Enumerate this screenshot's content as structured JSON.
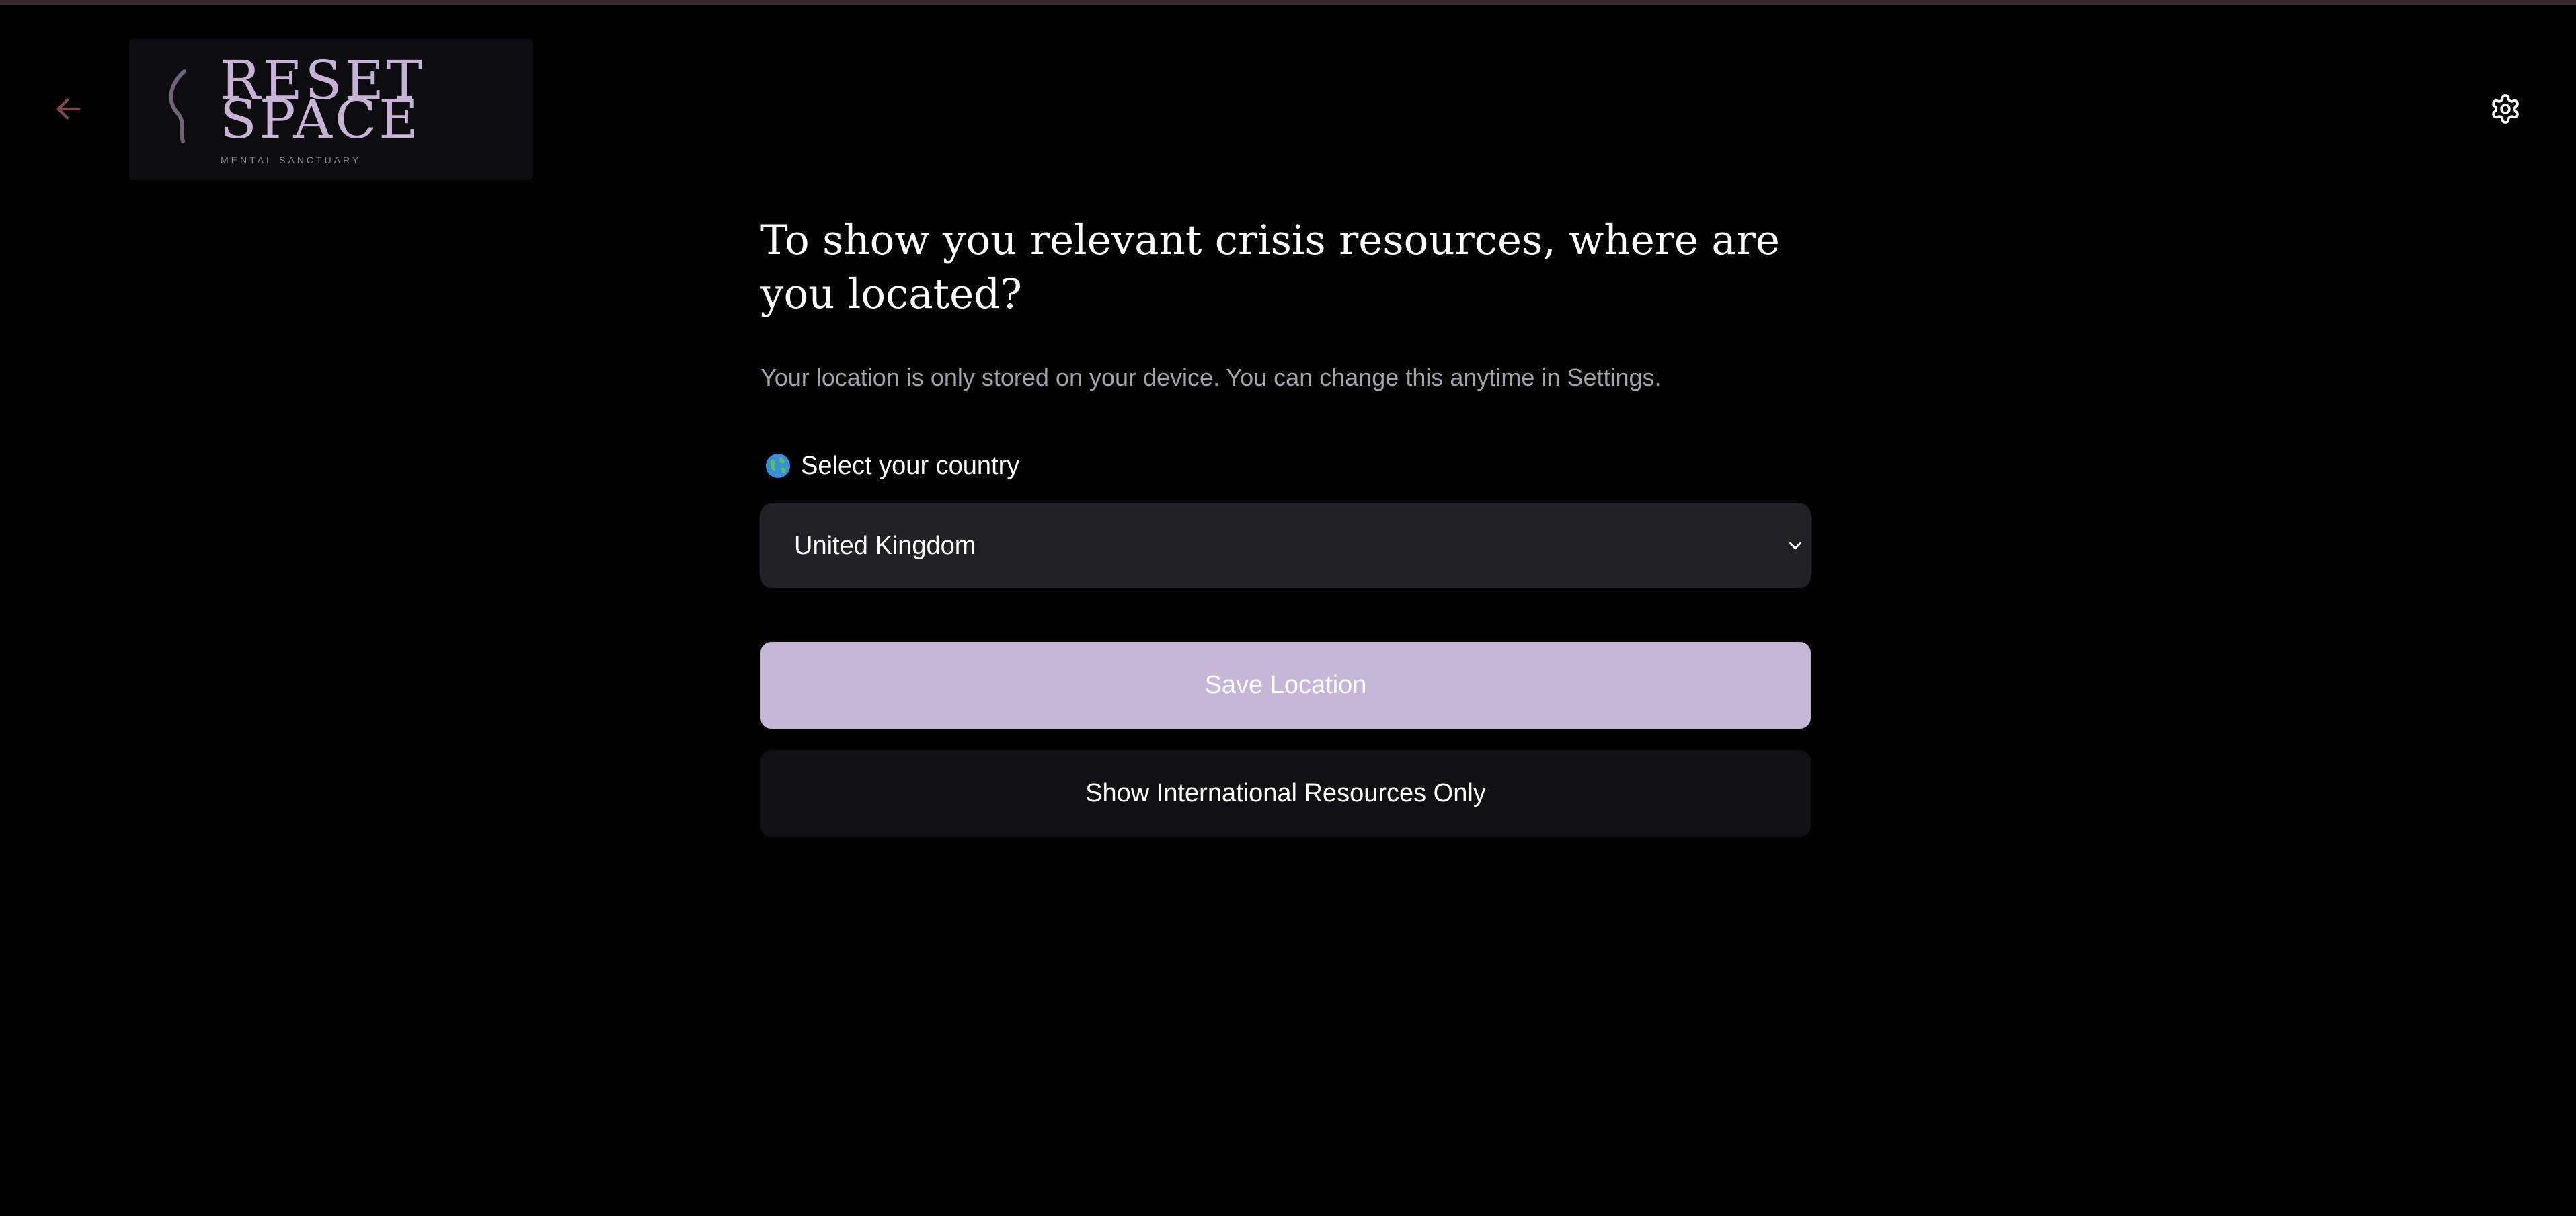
{
  "logo": {
    "line1": "RESET",
    "line2": "SPACE",
    "tagline": "MENTAL SANCTUARY"
  },
  "header": {
    "back_icon": "arrow-left-icon",
    "settings_icon": "gear-icon"
  },
  "main": {
    "question": "To show you relevant crisis resources, where are you located?",
    "privacy_note": "Your location is only stored on your device. You can change this anytime in Settings.",
    "country_label": "Select your country",
    "country_label_icon": "globe-icon",
    "selected_country": "United Kingdom",
    "save_label": "Save Location",
    "international_label": "Show International Resources Only"
  },
  "colors": {
    "background": "#030303",
    "accent": "#c6b6d8",
    "back_arrow": "#7a4a4e",
    "select_bg": "#222226",
    "secondary_button_bg": "#111113"
  }
}
